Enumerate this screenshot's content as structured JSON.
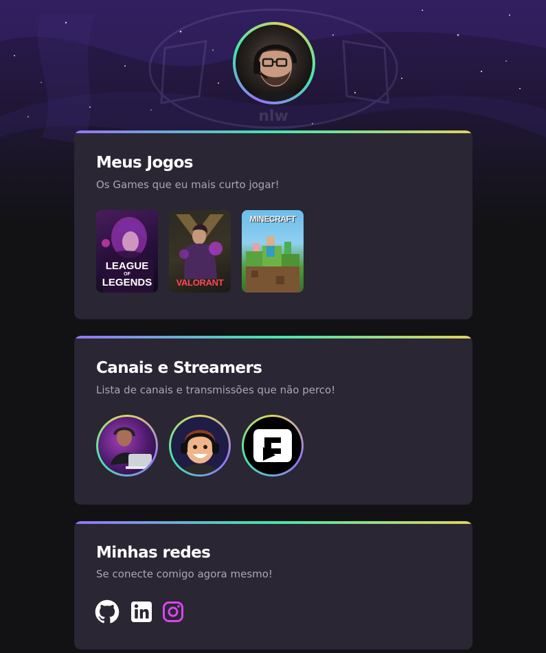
{
  "profile": {
    "avatar_alt": "Foto de perfil"
  },
  "games_card": {
    "title": "Meus Jogos",
    "subtitle": "Os Games que eu mais curto jogar!",
    "games": [
      {
        "name_line1": "LEAGUE",
        "name_line2": "LEGENDS",
        "of_text": "OF"
      },
      {
        "name": "VALORANT"
      },
      {
        "name": "MINECRAFT"
      }
    ]
  },
  "streamers_card": {
    "title": "Canais e Streamers",
    "subtitle": "Lista de canais e transmissões que não perco!",
    "streamers": [
      {
        "icon": "streamer-avatar-1"
      },
      {
        "icon": "streamer-avatar-2"
      },
      {
        "icon": "streamer-avatar-3"
      }
    ]
  },
  "social_card": {
    "title": "Minhas redes",
    "subtitle": "Se conecte comigo agora mesmo!",
    "links": [
      {
        "icon": "github-icon",
        "color": "#ffffff"
      },
      {
        "icon": "linkedin-icon",
        "color": "#ffffff"
      },
      {
        "icon": "instagram-icon",
        "color": "#D946EF"
      }
    ]
  },
  "background": {
    "watermark_text": "nlw"
  },
  "colors": {
    "card_bg": "#2A2634",
    "page_bg": "#121214",
    "gradient": [
      "#9572FC",
      "#43E7AD",
      "#E2D45C"
    ],
    "title": "#FFFFFF",
    "subtitle": "#A8A8B3"
  }
}
